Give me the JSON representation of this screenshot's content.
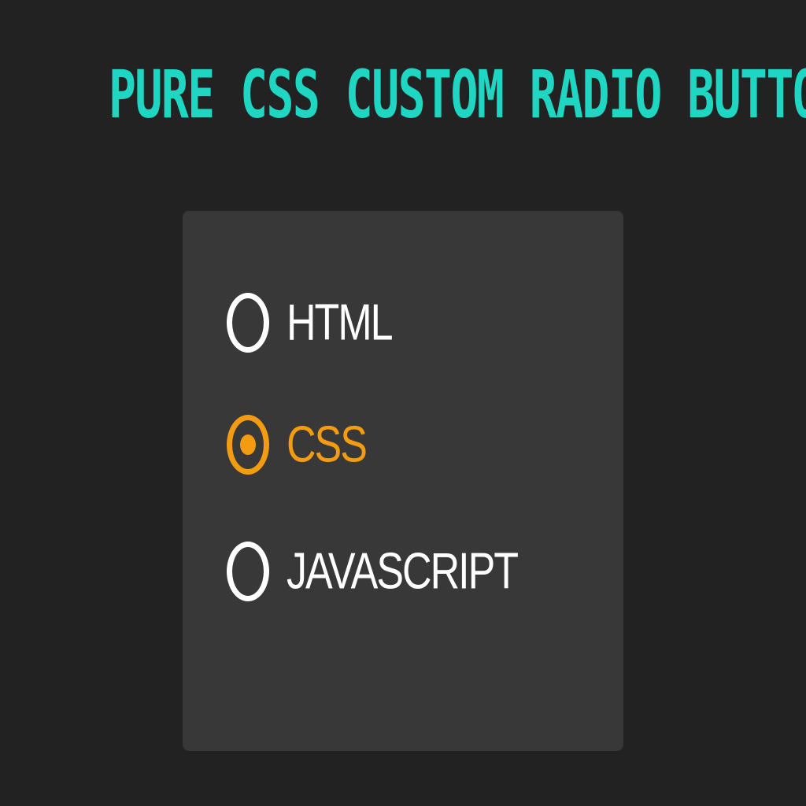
{
  "title": "PURE CSS CUSTOM RADIO BUTTON",
  "colors": {
    "background": "#222222",
    "panel": "#383838",
    "title": "#1fd6c2",
    "accent": "#f39c12",
    "unchecked": "#ffffff"
  },
  "options": [
    {
      "label": "HTML",
      "checked": false
    },
    {
      "label": "CSS",
      "checked": true
    },
    {
      "label": "JAVASCRIPT",
      "checked": false
    }
  ]
}
